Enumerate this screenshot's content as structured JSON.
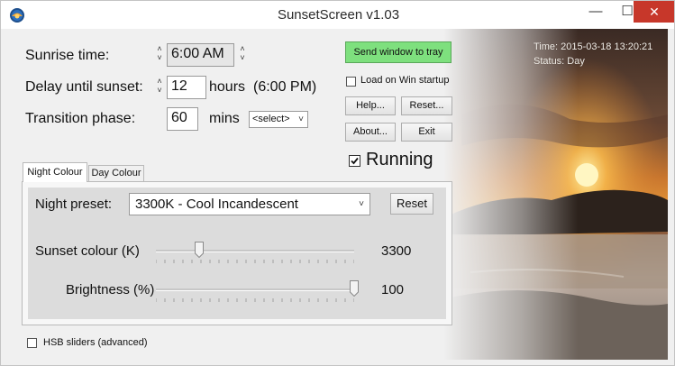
{
  "window": {
    "title": "SunsetScreen v1.03",
    "minimize": "—",
    "maximize": "☐",
    "close": "✕"
  },
  "settings": {
    "sunrise_label": "Sunrise time:",
    "sunrise_value": "6:00 AM",
    "delay_label": "Delay until sunset:",
    "delay_value": "12",
    "delay_unit": "hours",
    "sunset_time": "(6:00 PM)",
    "transition_label": "Transition phase:",
    "transition_value": "60",
    "transition_unit": "mins",
    "transition_select": "<select>"
  },
  "buttons": {
    "send_to_tray": "Send window to tray",
    "help": "Help...",
    "reset": "Reset...",
    "about": "About...",
    "exit": "Exit"
  },
  "options": {
    "load_on_startup": "Load on Win startup",
    "running": "Running",
    "hsb_sliders": "HSB sliders (advanced)"
  },
  "tabs": {
    "night": "Night Colour",
    "day": "Day Colour"
  },
  "panel": {
    "preset_label": "Night preset:",
    "preset_value": "3300K - Cool Incandescent",
    "preset_reset": "Reset",
    "sunset_colour_label": "Sunset colour (K)",
    "sunset_colour_value": "3300",
    "sunset_colour_fraction": 0.22,
    "brightness_label": "Brightness (%)",
    "brightness_value": "100",
    "brightness_fraction": 1.0
  },
  "status": {
    "time": "Time: 2015-03-18 13:20:21",
    "state": "Status: Day"
  },
  "colors": {
    "accent_green": "#7ee07e",
    "close_red": "#c7372a",
    "sky": "#c9762e",
    "sun": "#fff2a8"
  }
}
